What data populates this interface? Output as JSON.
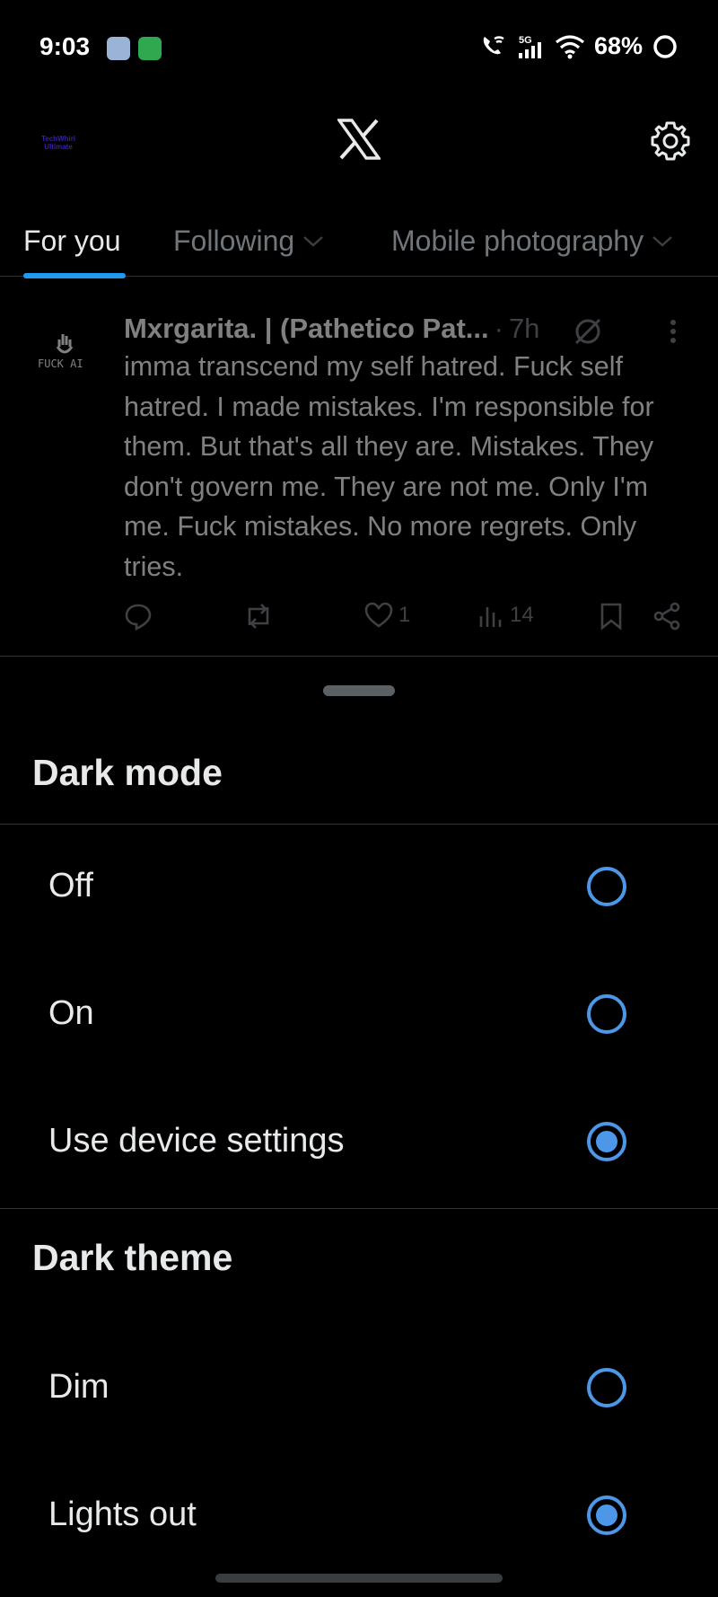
{
  "status_bar": {
    "time": "9:03",
    "battery": "68%",
    "network": "5G"
  },
  "header": {
    "account_logo_text": "TechWhirl Ultimate",
    "logo_icon": "x-logo-icon",
    "settings_icon": "gear-icon"
  },
  "tabs": [
    {
      "label": "For you",
      "active": true
    },
    {
      "label": "Following",
      "active": false
    },
    {
      "label": "Mobile photography",
      "active": false
    }
  ],
  "post": {
    "avatar_text": "FUCK AI",
    "author": "Mxrgarita. | (Pathetico Pat...",
    "separator": "·",
    "time": "7h",
    "text": "imma transcend my self hatred. Fuck self hatred. I made mistakes. I'm responsible for them. But that's all they are. Mistakes. They don't govern me. They are not me. Only I'm me. Fuck mistakes. No more regrets. Only tries.",
    "likes": "1",
    "views": "14"
  },
  "sheet": {
    "dark_mode_title": "Dark mode",
    "dark_mode_options": [
      {
        "label": "Off",
        "checked": false
      },
      {
        "label": "On",
        "checked": false
      },
      {
        "label": "Use device settings",
        "checked": true
      }
    ],
    "dark_theme_title": "Dark theme",
    "dark_theme_options": [
      {
        "label": "Dim",
        "checked": false
      },
      {
        "label": "Lights out",
        "checked": true
      }
    ]
  },
  "colors": {
    "accent": "#4c97e8",
    "tab_indicator": "#1d9bf0",
    "background": "#000000",
    "divider": "#2f3336"
  }
}
